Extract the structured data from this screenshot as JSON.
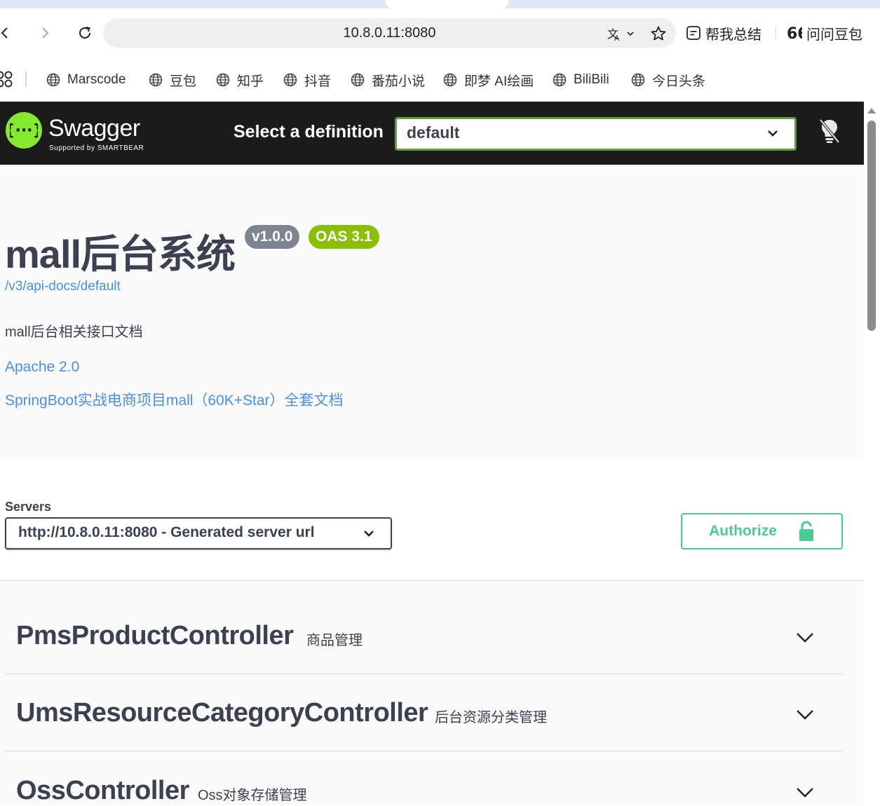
{
  "browser": {
    "url": "10.8.0.11:8080",
    "actions": {
      "summarize": "帮我总结",
      "ask": "问问豆包"
    },
    "bookmarks": [
      "Marscode",
      "豆包",
      "知乎",
      "抖音",
      "番茄小说",
      "即梦 AI绘画",
      "BiliBili",
      "今日头条"
    ]
  },
  "topbar": {
    "logo_text": "Swagger",
    "logo_sub": "Supported by SMARTBEAR",
    "definition_label": "Select a definition",
    "definition_value": "default"
  },
  "info": {
    "title": "mall后台系统",
    "version": "v1.0.0",
    "oas": "OAS 3.1",
    "api_docs_link": "/v3/api-docs/default",
    "description": "mall后台相关接口文档",
    "license": "Apache 2.0",
    "external_docs": "SpringBoot实战电商项目mall（60K+Star）全套文档"
  },
  "servers": {
    "label": "Servers",
    "selected": "http://10.8.0.11:8080 - Generated server url"
  },
  "authorize": {
    "label": "Authorize"
  },
  "tags": [
    {
      "name": "PmsProductController",
      "description": "商品管理"
    },
    {
      "name": "UmsResourceCategoryController",
      "description": "后台资源分类管理"
    },
    {
      "name": "OssController",
      "description": "Oss对象存储管理"
    }
  ],
  "colors": {
    "swagger_green": "#85ea2d",
    "topbar_bg": "#1b1b1b",
    "link_blue": "#4990e2",
    "authorize_green": "#49cc90",
    "oas_badge": "#89bf04",
    "version_badge": "#7d8492"
  }
}
